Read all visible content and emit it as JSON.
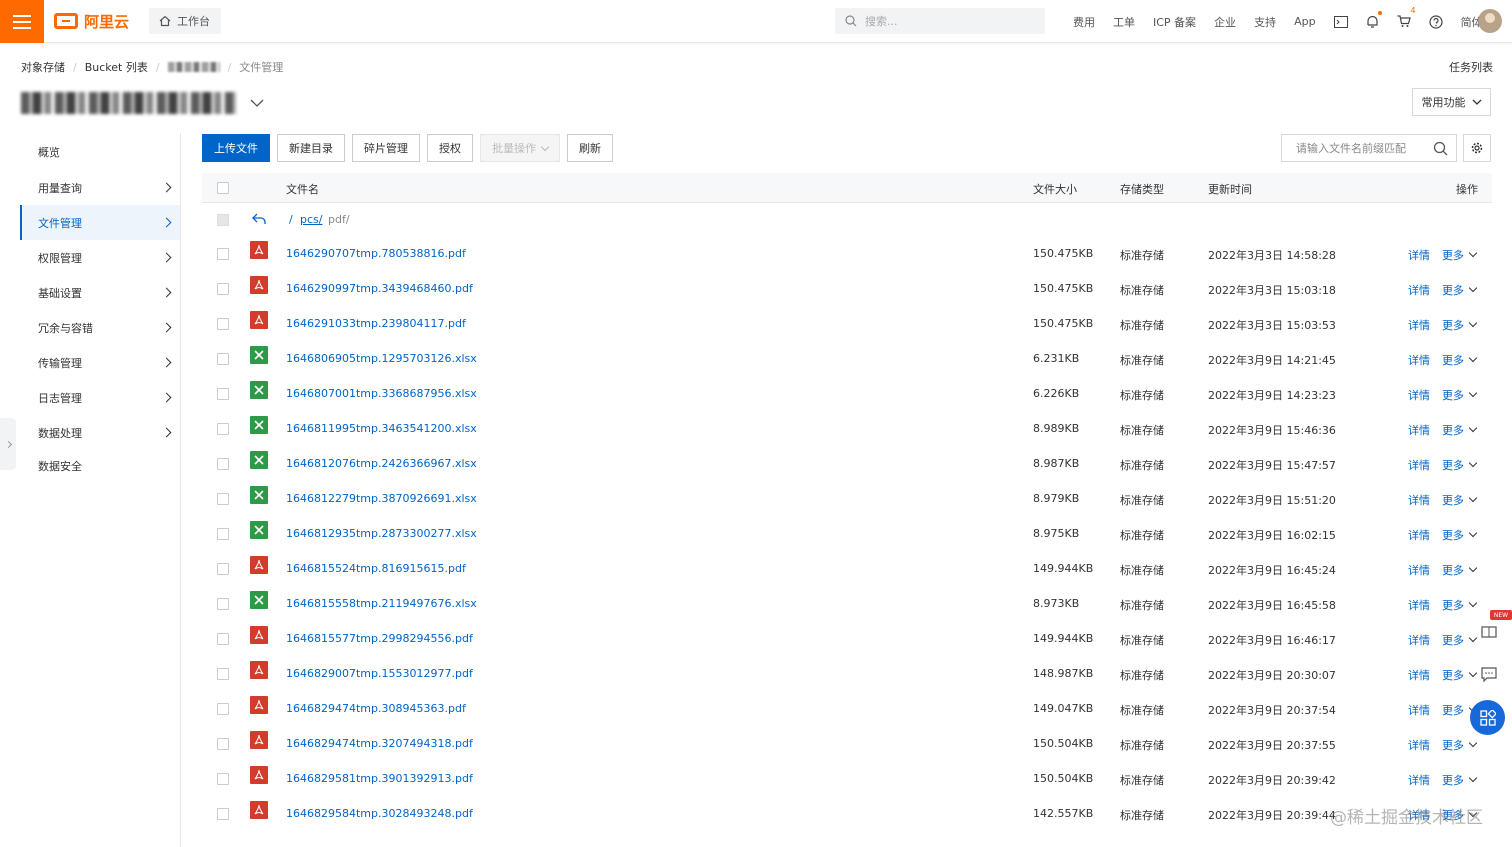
{
  "topbar": {
    "logo_text": "阿里云",
    "workbench_label": "工作台",
    "search_placeholder": "搜索...",
    "nav": [
      "费用",
      "工单",
      "ICP 备案",
      "企业",
      "支持",
      "App"
    ],
    "cart_badge": "4",
    "language": "简体"
  },
  "breadcrumb": {
    "items": [
      "对象存储",
      "Bucket 列表",
      "文件管理"
    ]
  },
  "task_list_label": "任务列表",
  "common_functions_label": "常用功能",
  "sidebar": {
    "items": [
      {
        "label": "概览",
        "chevron": false,
        "active": false
      },
      {
        "label": "用量查询",
        "chevron": true,
        "active": false
      },
      {
        "label": "文件管理",
        "chevron": true,
        "active": true
      },
      {
        "label": "权限管理",
        "chevron": true,
        "active": false
      },
      {
        "label": "基础设置",
        "chevron": true,
        "active": false
      },
      {
        "label": "冗余与容错",
        "chevron": true,
        "active": false
      },
      {
        "label": "传输管理",
        "chevron": true,
        "active": false
      },
      {
        "label": "日志管理",
        "chevron": true,
        "active": false
      },
      {
        "label": "数据处理",
        "chevron": true,
        "active": false
      },
      {
        "label": "数据安全",
        "chevron": false,
        "active": false
      }
    ]
  },
  "toolbar": {
    "upload": "上传文件",
    "new_dir": "新建目录",
    "fragments": "碎片管理",
    "authorize": "授权",
    "batch": "批量操作",
    "refresh": "刷新",
    "file_search_placeholder": "请输入文件名前缀匹配"
  },
  "table": {
    "headers": {
      "name": "文件名",
      "size": "文件大小",
      "storage": "存储类型",
      "updated": "更新时间",
      "actions": "操作"
    },
    "path": {
      "root": "/",
      "dir": "pcs/",
      "current": "pdf/"
    },
    "detail_label": "详情",
    "more_label": "更多",
    "rows": [
      {
        "type": "pdf",
        "name": "1646290707tmp.780538816.pdf",
        "size": "150.475KB",
        "storage": "标准存储",
        "updated": "2022年3月3日 14:58:28"
      },
      {
        "type": "pdf",
        "name": "1646290997tmp.3439468460.pdf",
        "size": "150.475KB",
        "storage": "标准存储",
        "updated": "2022年3月3日 15:03:18"
      },
      {
        "type": "pdf",
        "name": "1646291033tmp.239804117.pdf",
        "size": "150.475KB",
        "storage": "标准存储",
        "updated": "2022年3月3日 15:03:53"
      },
      {
        "type": "xlsx",
        "name": "1646806905tmp.1295703126.xlsx",
        "size": "6.231KB",
        "storage": "标准存储",
        "updated": "2022年3月9日 14:21:45"
      },
      {
        "type": "xlsx",
        "name": "1646807001tmp.3368687956.xlsx",
        "size": "6.226KB",
        "storage": "标准存储",
        "updated": "2022年3月9日 14:23:23"
      },
      {
        "type": "xlsx",
        "name": "1646811995tmp.3463541200.xlsx",
        "size": "8.989KB",
        "storage": "标准存储",
        "updated": "2022年3月9日 15:46:36"
      },
      {
        "type": "xlsx",
        "name": "1646812076tmp.2426366967.xlsx",
        "size": "8.987KB",
        "storage": "标准存储",
        "updated": "2022年3月9日 15:47:57"
      },
      {
        "type": "xlsx",
        "name": "1646812279tmp.3870926691.xlsx",
        "size": "8.979KB",
        "storage": "标准存储",
        "updated": "2022年3月9日 15:51:20"
      },
      {
        "type": "xlsx",
        "name": "1646812935tmp.2873300277.xlsx",
        "size": "8.975KB",
        "storage": "标准存储",
        "updated": "2022年3月9日 16:02:15"
      },
      {
        "type": "pdf",
        "name": "1646815524tmp.816915615.pdf",
        "size": "149.944KB",
        "storage": "标准存储",
        "updated": "2022年3月9日 16:45:24"
      },
      {
        "type": "xlsx",
        "name": "1646815558tmp.2119497676.xlsx",
        "size": "8.973KB",
        "storage": "标准存储",
        "updated": "2022年3月9日 16:45:58"
      },
      {
        "type": "pdf",
        "name": "1646815577tmp.2998294556.pdf",
        "size": "149.944KB",
        "storage": "标准存储",
        "updated": "2022年3月9日 16:46:17"
      },
      {
        "type": "pdf",
        "name": "1646829007tmp.1553012977.pdf",
        "size": "148.987KB",
        "storage": "标准存储",
        "updated": "2022年3月9日 20:30:07"
      },
      {
        "type": "pdf",
        "name": "1646829474tmp.308945363.pdf",
        "size": "149.047KB",
        "storage": "标准存储",
        "updated": "2022年3月9日 20:37:54"
      },
      {
        "type": "pdf",
        "name": "1646829474tmp.3207494318.pdf",
        "size": "150.504KB",
        "storage": "标准存储",
        "updated": "2022年3月9日 20:37:55"
      },
      {
        "type": "pdf",
        "name": "1646829581tmp.3901392913.pdf",
        "size": "150.504KB",
        "storage": "标准存储",
        "updated": "2022年3月9日 20:39:42"
      },
      {
        "type": "pdf",
        "name": "1646829584tmp.3028493248.pdf",
        "size": "142.557KB",
        "storage": "标准存储",
        "updated": "2022年3月9日 20:39:44"
      }
    ]
  },
  "float_new_badge": "NEW",
  "watermark": "@稀土掘金技术社区",
  "colors": {
    "brand": "#ff6a00",
    "link": "#0064c8",
    "pdf": "#d23c2a",
    "xlsx": "#2e9a48"
  }
}
